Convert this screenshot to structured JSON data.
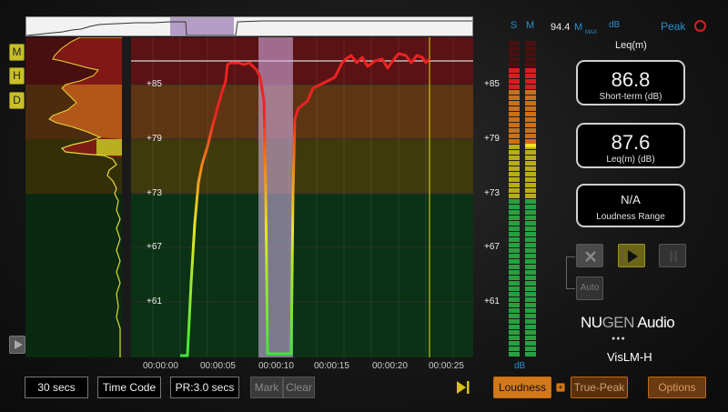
{
  "plugin": {
    "brand_part1": "NU",
    "brand_part2": "GEN",
    "brand_part3": " Audio",
    "product": "VisLM-H",
    "dots": "●●●"
  },
  "side_buttons": [
    "M",
    "H",
    "D"
  ],
  "graph": {
    "scale_labels": [
      "+85",
      "+79",
      "+73",
      "+67",
      "+61"
    ],
    "time_labels": [
      "00:00:00",
      "00:00:05",
      "00:00:10",
      "00:00:15",
      "00:00:20",
      "00:00:25"
    ]
  },
  "meters": {
    "s_label": "S",
    "m_label": "M",
    "unit_label": "dB"
  },
  "readouts": {
    "peak_value": "94.4",
    "peak_m": "M",
    "peak_max": "MAX",
    "peak_db": "dB",
    "peak_label": "Peak",
    "leq_title": "Leq(m)",
    "short_term": {
      "value": "86.8",
      "caption": "Short-term (dB)"
    },
    "leqm": {
      "value": "87.6",
      "caption": "Leq(m) (dB)"
    },
    "range": {
      "value": "N/A",
      "caption": "Loudness Range"
    }
  },
  "controls": {
    "auto_label": "Auto",
    "clear_icon": "x-icon",
    "play_icon": "play-icon",
    "pause_icon": "pause-icon"
  },
  "bottom_bar": {
    "window": "30 secs",
    "time_mode": "Time Code",
    "pr": "PR:3.0 secs",
    "mark": "Mark",
    "clear": "Clear",
    "loudness": "Loudness",
    "true_peak": "True-Peak",
    "options": "Options",
    "link_symbol": "+"
  },
  "colors": {
    "accent_blue": "#2b8fd0",
    "orange": "#d2781a",
    "yellow": "#c8bf2a",
    "green": "#1e9a3a",
    "red": "#e02020"
  }
}
